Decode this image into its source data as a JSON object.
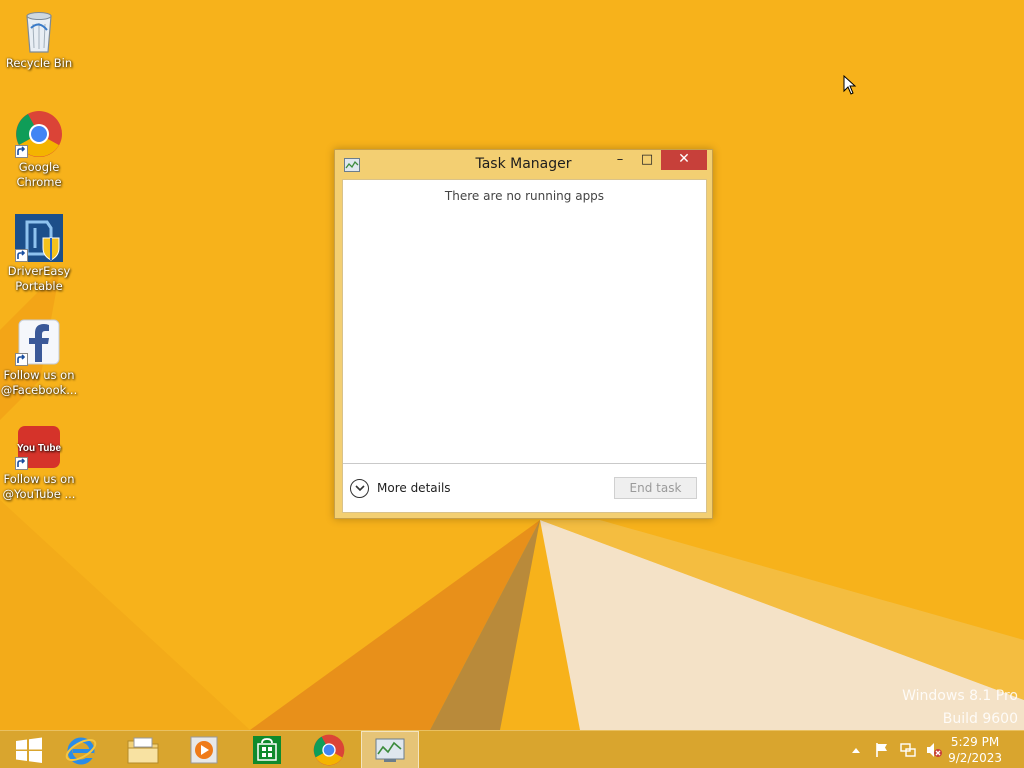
{
  "desktop": {
    "icons": [
      {
        "label": "Recycle Bin"
      },
      {
        "label": "Google Chrome",
        "line1": "Google",
        "line2": "Chrome"
      },
      {
        "label": "DriverEasy Portable",
        "line1": "DriverEasy",
        "line2": "Portable"
      },
      {
        "label": "Follow us on @Facebook...",
        "line1": "Follow us on",
        "line2": "@Facebook..."
      },
      {
        "label": "Follow us on @YouTube ...",
        "line1": "Follow us on",
        "line2": "@YouTube ...",
        "logo_text": "You Tube"
      }
    ]
  },
  "task_manager": {
    "title": "Task Manager",
    "empty_message": "There are no running apps",
    "more_details_label": "More details",
    "end_task_label": "End task",
    "minimize_glyph": "–",
    "maximize_glyph": "□",
    "close_glyph": "✕"
  },
  "watermark": {
    "line1": "Windows 8.1 Pro",
    "line2": "Build 9600"
  },
  "taskbar": {
    "items": [
      {
        "name": "start-button"
      },
      {
        "name": "internet-explorer"
      },
      {
        "name": "file-explorer"
      },
      {
        "name": "media-player"
      },
      {
        "name": "store"
      },
      {
        "name": "google-chrome"
      },
      {
        "name": "task-manager",
        "active": true
      }
    ],
    "tray": {
      "time": "5:29 PM",
      "date": "9/2/2023"
    }
  },
  "colors": {
    "wallpaper": "#f7b21b",
    "window_frame": "#f3cf72",
    "close_button": "#c7403a",
    "taskbar": "#d9a52e"
  }
}
